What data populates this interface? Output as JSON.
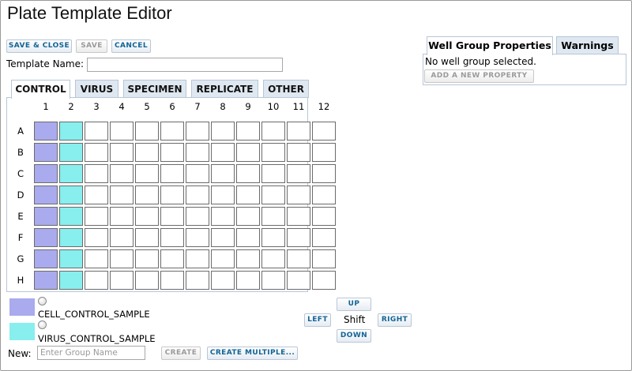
{
  "page": {
    "title": "Plate Template Editor"
  },
  "toolbar": {
    "save_close_label": "SAVE & CLOSE",
    "save_label": "SAVE",
    "cancel_label": "CANCEL"
  },
  "template_name": {
    "label": "Template Name:",
    "value": ""
  },
  "tabs": [
    {
      "label": "CONTROL",
      "active": true
    },
    {
      "label": "VIRUS",
      "active": false
    },
    {
      "label": "SPECIMEN",
      "active": false
    },
    {
      "label": "REPLICATE",
      "active": false
    },
    {
      "label": "OTHER",
      "active": false
    }
  ],
  "plate": {
    "columns": [
      "1",
      "2",
      "3",
      "4",
      "5",
      "6",
      "7",
      "8",
      "9",
      "10",
      "11",
      "12"
    ],
    "rows": [
      "A",
      "B",
      "C",
      "D",
      "E",
      "F",
      "G",
      "H"
    ],
    "column_groups": {
      "1": "CELL_CONTROL_SAMPLE",
      "2": "VIRUS_CONTROL_SAMPLE"
    }
  },
  "groups": [
    {
      "name": "CELL_CONTROL_SAMPLE",
      "color": "#aaaaee"
    },
    {
      "name": "VIRUS_CONTROL_SAMPLE",
      "color": "#88eeee"
    }
  ],
  "shift": {
    "up_label": "UP",
    "down_label": "DOWN",
    "left_label": "LEFT",
    "right_label": "RIGHT",
    "center_label": "Shift"
  },
  "new_group": {
    "label": "New:",
    "placeholder": "Enter Group Name",
    "create_label": "CREATE",
    "create_multiple_label": "CREATE MULTIPLE..."
  },
  "right_panel": {
    "tabs": [
      {
        "label": "Well Group Properties",
        "active": true
      },
      {
        "label": "Warnings",
        "active": false
      }
    ],
    "status_text": "No well group selected.",
    "add_property_label": "ADD A NEW PROPERTY"
  }
}
